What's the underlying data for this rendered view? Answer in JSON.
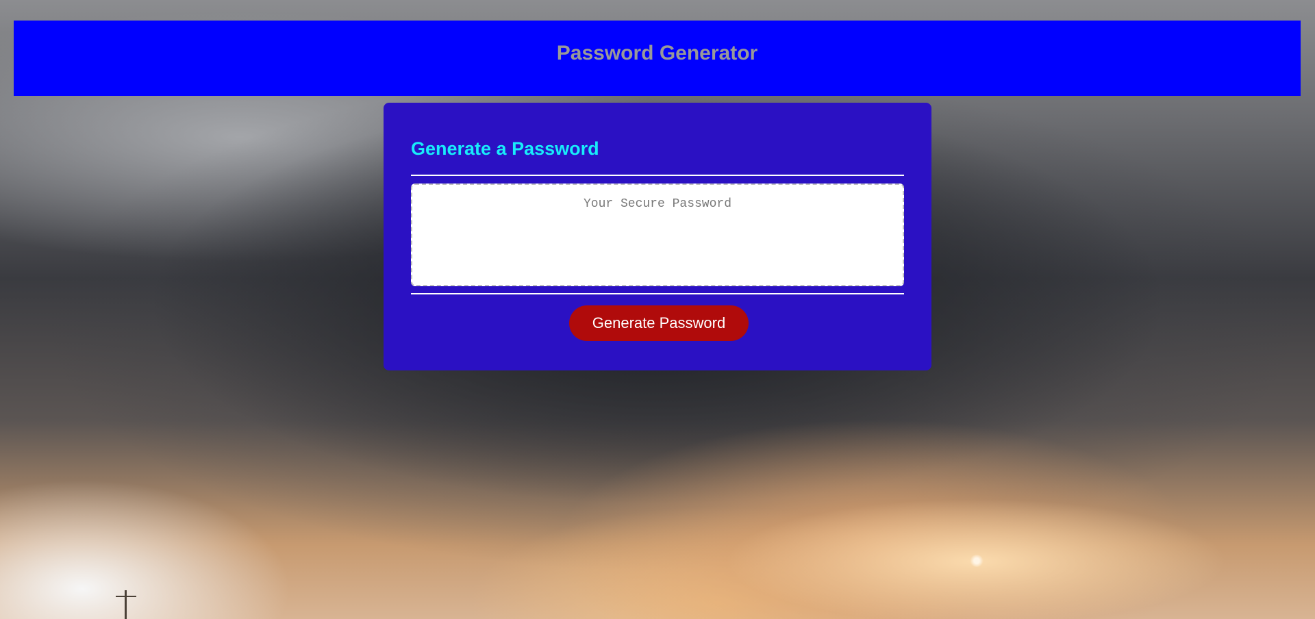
{
  "header": {
    "title": "Password Generator"
  },
  "card": {
    "title": "Generate a Password",
    "password_field": {
      "value": "",
      "placeholder": "Your Secure Password"
    },
    "generate_button_label": "Generate Password"
  },
  "colors": {
    "header_background": "#0000ff",
    "header_text": "#999999",
    "card_background": "#2b11c3",
    "card_title": "#18ecfa",
    "button_background": "#b00b0b",
    "button_text": "#ffffff"
  }
}
